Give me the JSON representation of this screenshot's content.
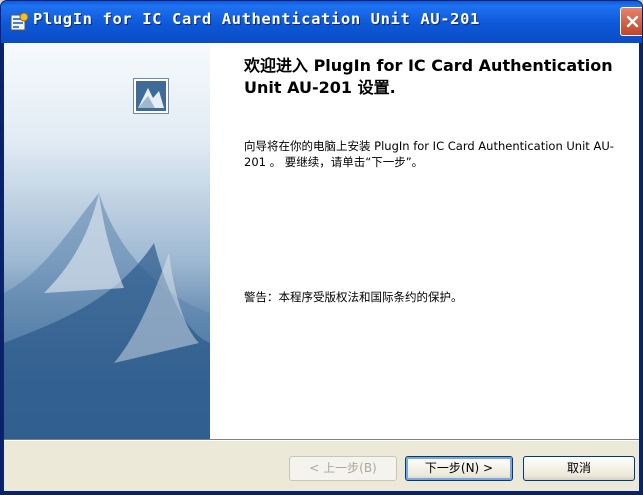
{
  "window": {
    "title": "PlugIn for IC Card Authentication Unit AU-201",
    "app_icon": "installer-icon",
    "close_icon": "close-icon"
  },
  "side_panel": {
    "logo_icon": "product-logo-icon"
  },
  "main": {
    "welcome_title": "欢迎进入 PlugIn for IC Card Authentication Unit AU-201 设置.",
    "intro_text": "向导将在你的电脑上安装 PlugIn for IC Card Authentication Unit AU-201 。 要继续，请单击“下一步”。",
    "warning_text": "警告：本程序受版权法和国际条约的保护。"
  },
  "buttons": {
    "back_label": "< 上一步(B)",
    "next_label": "下一步(N) >",
    "cancel_label": "取消"
  },
  "colors": {
    "titlebar": "#0a5ddf",
    "close_button": "#c0442c",
    "button_bar": "#ece9d8"
  }
}
